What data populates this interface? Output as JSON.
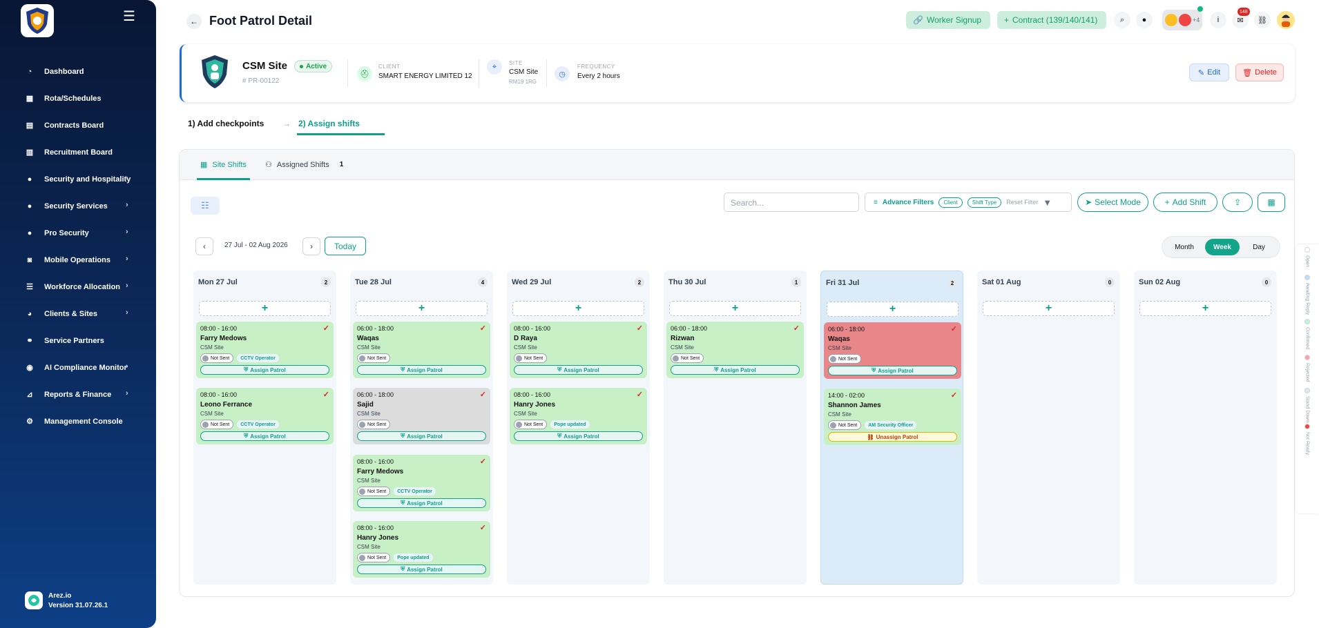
{
  "sidebar": {
    "items": [
      {
        "label": "Dashboard",
        "icon": "dashboard-icon",
        "chevron": false
      },
      {
        "label": "Rota/Schedules",
        "icon": "calendar-icon",
        "chevron": false
      },
      {
        "label": "Contracts Board",
        "icon": "contracts-icon",
        "chevron": false
      },
      {
        "label": "Recruitment Board",
        "icon": "clipboard-icon",
        "chevron": false
      },
      {
        "label": "Security and Hospitality",
        "icon": "user-icon",
        "chevron": true
      },
      {
        "label": "Security Services",
        "icon": "user-icon",
        "chevron": true
      },
      {
        "label": "Pro Security",
        "icon": "user-icon",
        "chevron": true
      },
      {
        "label": "Mobile Operations",
        "icon": "car-icon",
        "chevron": true
      },
      {
        "label": "Workforce Allocation",
        "icon": "list-icon",
        "chevron": true
      },
      {
        "label": "Clients & Sites",
        "icon": "clients-icon",
        "chevron": true
      },
      {
        "label": "Service Partners",
        "icon": "handshake-icon",
        "chevron": false
      },
      {
        "label": "AI Compliance Monitor",
        "icon": "robot-icon",
        "chevron": true
      },
      {
        "label": "Reports & Finance",
        "icon": "chart-icon",
        "chevron": true
      },
      {
        "label": "Management Console",
        "icon": "gears-icon",
        "chevron": false
      }
    ],
    "footer": {
      "name": "Arez.io",
      "version": "Version 31.07.26.1"
    }
  },
  "header": {
    "title": "Foot Patrol Detail",
    "worker_signup": "Worker Signup",
    "contract": "Contract (139/140/141)",
    "avatars_more": "+4",
    "notif_count": "148"
  },
  "site": {
    "name": "CSM Site",
    "status": "Active",
    "id": "# PR-00122",
    "client_label": "CLIENT",
    "client_value": "SMART ENERGY LIMITED 12",
    "site_label": "SITE",
    "site_value": "CSM Site",
    "site_postcode": "RM19 1RG",
    "freq_label": "FREQUENCY",
    "freq_value": "Every 2 hours",
    "edit": "Edit",
    "delete": "Delete"
  },
  "steps": {
    "step1": "1) Add checkpoints",
    "step2": "2) Assign shifts"
  },
  "tabs": {
    "site_shifts": "Site Shifts",
    "assigned_shifts": "Assigned Shifts",
    "assigned_count": "1"
  },
  "toolbar": {
    "search_placeholder": "Search...",
    "advance_filters": "Advance Filters",
    "chip_client": "Client",
    "chip_shift_type": "Shift Type",
    "reset_filter": "Reset Filter",
    "select_mode": "Select Mode",
    "add_shift": "Add Shift"
  },
  "calendar": {
    "range": "27 Jul - 02 Aug 2026",
    "today": "Today",
    "views": [
      "Month",
      "Week",
      "Day"
    ],
    "active_view": "Week",
    "days": [
      {
        "label": "Mon 27 Jul",
        "count": "2",
        "shifts": [
          {
            "time": "08:00 - 16:00",
            "name": "Farry Medows",
            "site": "CSM Site",
            "status": "Not Sent",
            "role": "CCTV Operator",
            "action": "Assign Patrol",
            "color": "green"
          },
          {
            "time": "08:00 - 16:00",
            "name": "Leono Ferrance",
            "site": "CSM Site",
            "status": "Not Sent",
            "role": "CCTV Operator",
            "action": "Assign Patrol",
            "color": "green"
          }
        ]
      },
      {
        "label": "Tue 28 Jul",
        "count": "4",
        "shifts": [
          {
            "time": "06:00 - 18:00",
            "name": "Waqas",
            "site": "CSM Site",
            "status": "Not Sent",
            "role": "",
            "action": "Assign Patrol",
            "color": "green"
          },
          {
            "time": "06:00 - 18:00",
            "name": "Sajid",
            "site": "CSM Site",
            "status": "Not Sent",
            "role": "",
            "action": "Assign Patrol",
            "color": "grey"
          },
          {
            "time": "08:00 - 16:00",
            "name": "Farry Medows",
            "site": "CSM Site",
            "status": "Not Sent",
            "role": "CCTV Operator",
            "action": "Assign Patrol",
            "color": "green"
          },
          {
            "time": "08:00 - 16:00",
            "name": "Hanry Jones",
            "site": "CSM Site",
            "status": "Not Sent",
            "role": "Pope updated",
            "action": "Assign Patrol",
            "color": "green"
          }
        ]
      },
      {
        "label": "Wed 29 Jul",
        "count": "2",
        "shifts": [
          {
            "time": "08:00 - 16:00",
            "name": "D Raya",
            "site": "CSM Site",
            "status": "Not Sent",
            "role": "",
            "action": "Assign Patrol",
            "color": "green"
          },
          {
            "time": "08:00 - 16:00",
            "name": "Hanry Jones",
            "site": "CSM Site",
            "status": "Not Sent",
            "role": "Pope updated",
            "action": "Assign Patrol",
            "color": "green"
          }
        ]
      },
      {
        "label": "Thu 30 Jul",
        "count": "1",
        "shifts": [
          {
            "time": "06:00 - 18:00",
            "name": "Rizwan",
            "site": "CSM Site",
            "status": "Not Sent",
            "role": "",
            "action": "Assign Patrol",
            "color": "green"
          }
        ]
      },
      {
        "label": "Fri 31 Jul",
        "count": "2",
        "shifts": [
          {
            "time": "06:00 - 18:00",
            "name": "Waqas",
            "site": "CSM Site",
            "status": "Not Sent",
            "role": "",
            "action": "Assign Patrol",
            "color": "red"
          },
          {
            "time": "14:00 - 02:00",
            "name": "Shannon James",
            "site": "CSM Site",
            "status": "Not Sent",
            "role": "AM Security Officer",
            "action": "Unassign Patrol",
            "color": "green"
          }
        ]
      },
      {
        "label": "Sat 01 Aug",
        "count": "0",
        "shifts": []
      },
      {
        "label": "Sun 02 Aug",
        "count": "0",
        "shifts": []
      }
    ]
  },
  "legend": [
    {
      "label": "Open",
      "color": "#ffffff"
    },
    {
      "label": "Awaiting Reply",
      "color": "#bfdbfe"
    },
    {
      "label": "Confirmed",
      "color": "#bbf7d0"
    },
    {
      "label": "Rejected",
      "color": "#fca5a5"
    },
    {
      "label": "Stand Down",
      "color": "#e5e7eb"
    },
    {
      "label": "Not Ready",
      "color": "#ef4444"
    }
  ],
  "colors": {
    "accent": "#0e9f8d",
    "sidebar": "#0b2a5c",
    "shift_green": "#c8f0c6",
    "shift_grey": "#dcdcdc",
    "shift_red": "#e9868a"
  }
}
